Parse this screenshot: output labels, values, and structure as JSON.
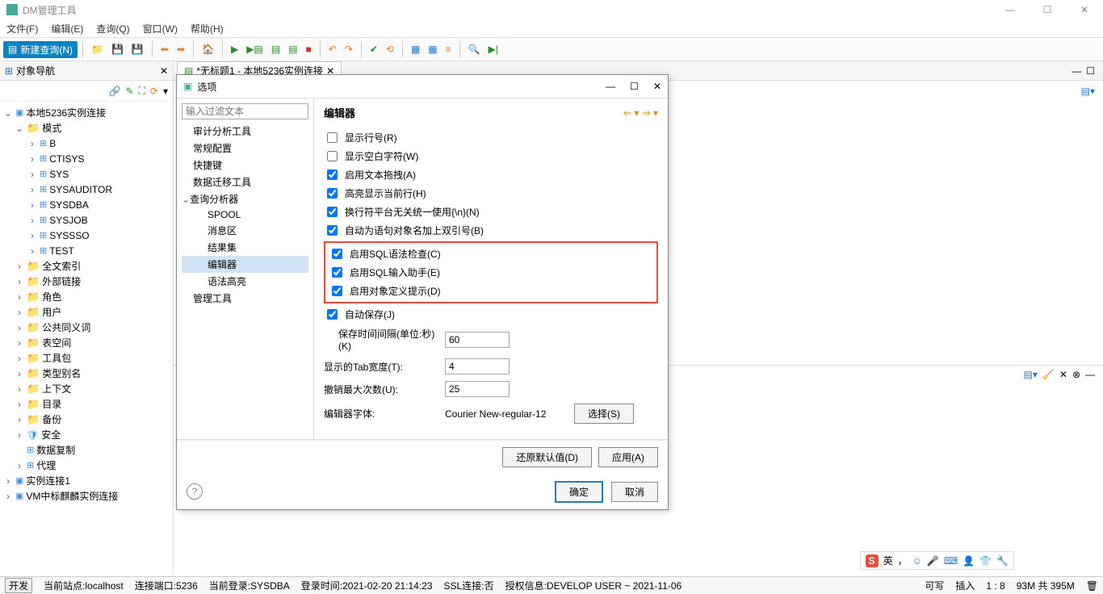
{
  "window": {
    "title": "DM管理工具"
  },
  "menu": [
    "文件(F)",
    "编辑(E)",
    "查询(Q)",
    "窗口(W)",
    "帮助(H)"
  ],
  "toolbar": {
    "new_query": "新建查询(N)"
  },
  "sidebar": {
    "tab": "对象导航",
    "root": "本地5236实例连接",
    "schema": "模式",
    "schemas": [
      "B",
      "CTISYS",
      "SYS",
      "SYSAUDITOR",
      "SYSDBA",
      "SYSJOB",
      "SYSSSO",
      "TEST"
    ],
    "folders": [
      "全文索引",
      "外部链接",
      "角色",
      "用户",
      "公共同义词",
      "表空间",
      "工具包",
      "类型别名",
      "上下文",
      "目录",
      "备份",
      "安全",
      "数据复制",
      "代理"
    ],
    "extra": [
      "实例连接1",
      "VM中标麒麟实例连接"
    ]
  },
  "editor_tab": "*无标题1 - 本地5236实例连接",
  "dialog": {
    "title": "选项",
    "filter_placeholder": "输入过滤文本",
    "tree": {
      "audit": "审计分析工具",
      "general": "常规配置",
      "shortcut": "快捷键",
      "migrate": "数据迁移工具",
      "query": "查询分析器",
      "spool": "SPOOL",
      "msg": "消息区",
      "result": "结果集",
      "editor": "编辑器",
      "syntax": "语法高亮",
      "manage": "管理工具"
    },
    "right_title": "编辑器",
    "checks": {
      "show_line": "显示行号(R)",
      "show_space": "显示空白字符(W)",
      "drag_text": "启用文本拖拽(A)",
      "highlight_line": "高亮显示当前行(H)",
      "newline": "换行符平台无关统一使用{\\n}(N)",
      "auto_quote": "自动为语句对象名加上双引号(B)",
      "sql_check": "启用SQL语法检查(C)",
      "sql_assist": "启用SQL输入助手(E)",
      "obj_hint": "启用对象定义提示(D)",
      "autosave": "自动保存(J)"
    },
    "fields": {
      "save_interval_lbl": "保存时间间隔(单位:秒)(K)",
      "save_interval": "60",
      "tab_width_lbl": "显示的Tab宽度(T):",
      "tab_width": "4",
      "undo_lbl": "撤销最大次数(U):",
      "undo": "25",
      "font_lbl": "编辑器字体:",
      "font_val": "Courier New-regular-12",
      "choose": "选择(S)"
    },
    "buttons": {
      "restore": "还原默认值(D)",
      "apply": "应用(A)",
      "ok": "确定",
      "cancel": "取消"
    }
  },
  "status": {
    "dev": "开发",
    "site": "当前站点:localhost",
    "port": "连接端口:5236",
    "login": "当前登录:SYSDBA",
    "time": "登录时间:2021-02-20 21:14:23",
    "ssl": "SSL连接:否",
    "auth": "授权信息:DEVELOP USER ~ 2021-11-06",
    "rw": "可写",
    "ins": "插入",
    "pos": "1 : 8",
    "mem": "93M 共 395M"
  },
  "ime": "英"
}
